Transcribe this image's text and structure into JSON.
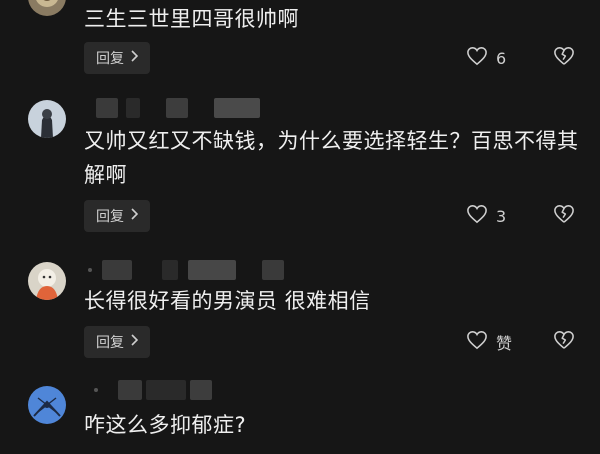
{
  "comments": [
    {
      "text": "三生三世里四哥很帅啊",
      "reply_label": "回复",
      "like_count": "6"
    },
    {
      "text": "又帅又红又不缺钱，为什么要选择轻生？百思不得其解啊",
      "reply_label": "回复",
      "like_count": "3"
    },
    {
      "text": "长得很好看的男演员 很难相信",
      "reply_label": "回复",
      "like_count": "赞"
    },
    {
      "text": "咋这么多抑郁症?"
    }
  ],
  "icons": {
    "like": "heart-outline-icon",
    "dislike": "broken-heart-icon",
    "reply_chevron": "chevron-right-icon"
  },
  "colors": {
    "background": "#161616",
    "text": "#efefef",
    "button_bg": "#2a2a2a",
    "icon": "#cfcfcf"
  }
}
